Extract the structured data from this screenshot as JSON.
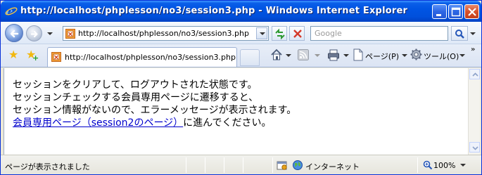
{
  "window": {
    "title": "http://localhost/phplesson/no3/session3.php - Windows Internet Explorer"
  },
  "navigation": {
    "address_url": "http://localhost/phplesson/no3/session3.php",
    "search_placeholder": "Google"
  },
  "tabs": [
    {
      "label": "http://localhost/phplesson/no3/session3.php",
      "active": true
    }
  ],
  "commands": {
    "page_label": "ページ(P)",
    "tools_label": "ツール(O)"
  },
  "content": {
    "lines": [
      "セッションをクリアして、ログアウトされた状態です。",
      "セッションチェックする会員専用ページに遷移すると、",
      "セッション情報がないので、エラーメッセージが表示されます。"
    ],
    "link_text": "会員専用ページ（session2のページ）",
    "link_suffix": "に進んでください。"
  },
  "statusbar": {
    "status_text": "ページが表示されました",
    "zone_text": "インターネット",
    "zoom_text": "100%"
  },
  "colors": {
    "title_bar": "#0054e3",
    "link": "#0000cc"
  }
}
